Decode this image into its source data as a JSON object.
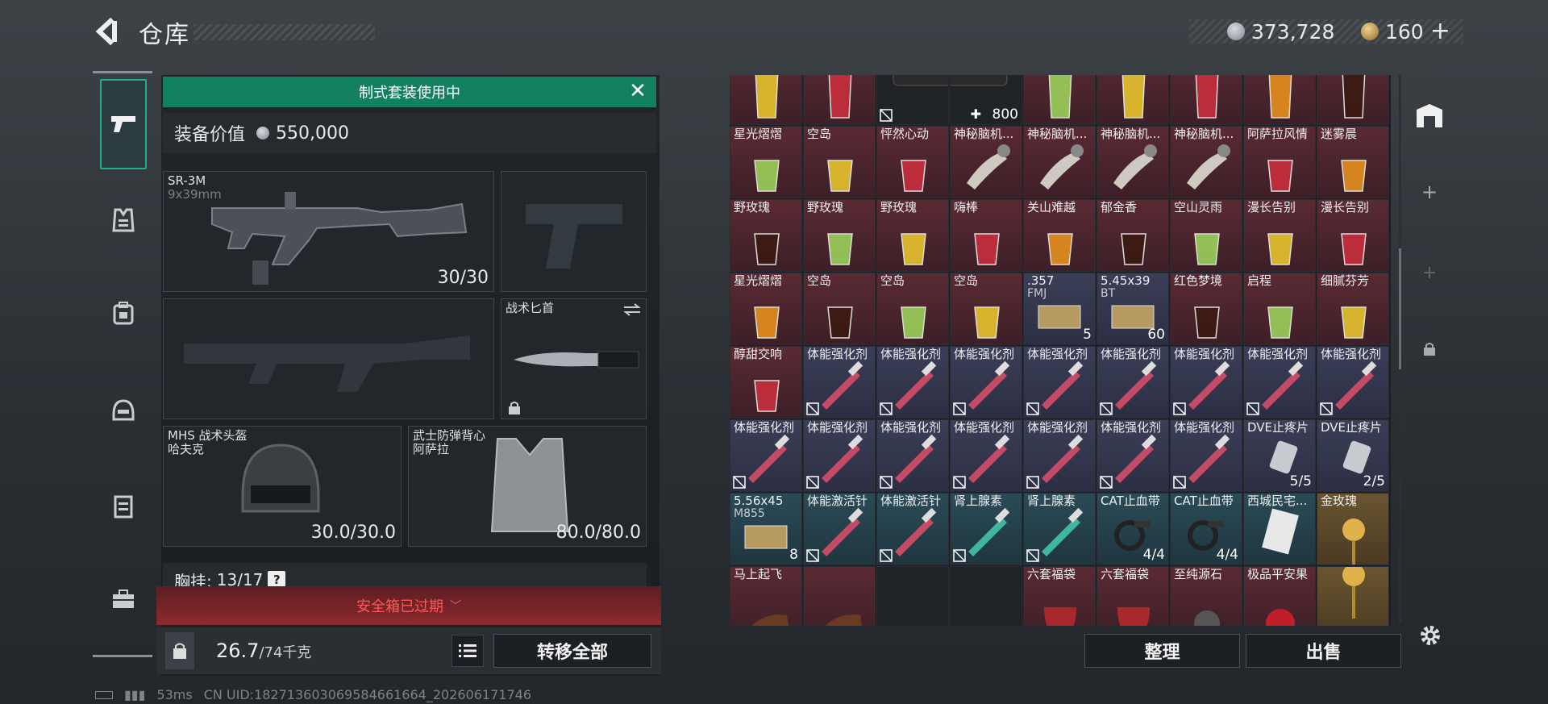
{
  "header": {
    "title": "仓库",
    "currency1": "373,728",
    "currency2": "160",
    "plus": "+"
  },
  "equip": {
    "banner": "制式套装使用中",
    "value_label": "装备价值",
    "value": "550,000",
    "primary": {
      "name": "SR-3M",
      "ammo": "9x39mm",
      "count": "30/30"
    },
    "knife": {
      "name": "战术匕首"
    },
    "helmet": {
      "name": "MHS 战术头盔",
      "sub": "哈夫克",
      "count": "30.0/30.0"
    },
    "armor": {
      "name": "武士防弹背心",
      "sub": "阿萨拉",
      "count": "80.0/80.0"
    },
    "vest_label": "胸挂:",
    "vest_count": "13/17",
    "vest_help": "?",
    "safe_box": "安全箱已过期",
    "weight": "26.7",
    "weight_max": "/74千克",
    "transfer": "转移全部"
  },
  "grid": {
    "rows": [
      [
        {
          "n": "",
          "q": "",
          "t": "red"
        },
        {
          "n": "",
          "q": "",
          "t": "red"
        },
        {
          "n": "",
          "q": "",
          "t": "dark"
        },
        {
          "n": "",
          "q": "800",
          "t": "dark"
        },
        {
          "n": "",
          "q": "",
          "t": "red"
        },
        {
          "n": "",
          "q": "",
          "t": "red"
        },
        {
          "n": "",
          "q": "",
          "t": "red"
        },
        {
          "n": "",
          "q": "",
          "t": "red"
        },
        {
          "n": "",
          "q": "",
          "t": "red"
        }
      ],
      [
        {
          "n": "星光熠熠",
          "q": "",
          "t": "red"
        },
        {
          "n": "空岛",
          "q": "",
          "t": "red"
        },
        {
          "n": "怦然心动",
          "q": "",
          "t": "red"
        },
        {
          "n": "神秘脑机...",
          "q": "",
          "t": "red"
        },
        {
          "n": "神秘脑机...",
          "q": "",
          "t": "red"
        },
        {
          "n": "神秘脑机...",
          "q": "",
          "t": "red"
        },
        {
          "n": "神秘脑机...",
          "q": "",
          "t": "red"
        },
        {
          "n": "阿萨拉风情",
          "q": "",
          "t": "red"
        },
        {
          "n": "迷雾晨",
          "q": "",
          "t": "red"
        }
      ],
      [
        {
          "n": "野玫瑰",
          "q": "",
          "t": "red"
        },
        {
          "n": "野玫瑰",
          "q": "",
          "t": "red"
        },
        {
          "n": "野玫瑰",
          "q": "",
          "t": "red"
        },
        {
          "n": "嗨棒",
          "q": "",
          "t": "red"
        },
        {
          "n": "关山难越",
          "q": "",
          "t": "red"
        },
        {
          "n": "郁金香",
          "q": "",
          "t": "red"
        },
        {
          "n": "空山灵雨",
          "q": "",
          "t": "red"
        },
        {
          "n": "漫长告别",
          "q": "",
          "t": "red"
        },
        {
          "n": "漫长告别",
          "q": "",
          "t": "red"
        }
      ],
      [
        {
          "n": "星光熠熠",
          "q": "",
          "t": "red"
        },
        {
          "n": "空岛",
          "q": "",
          "t": "red"
        },
        {
          "n": "空岛",
          "q": "",
          "t": "red"
        },
        {
          "n": "空岛",
          "q": "",
          "t": "red"
        },
        {
          "n": ".357",
          "n2": "FMJ",
          "q": "5",
          "t": "blue"
        },
        {
          "n": "5.45x39",
          "n2": "BT",
          "q": "60",
          "t": "blue"
        },
        {
          "n": "红色梦境",
          "q": "",
          "t": "red"
        },
        {
          "n": "启程",
          "q": "",
          "t": "red"
        },
        {
          "n": "细腻芬芳",
          "q": "",
          "t": "red"
        }
      ],
      [
        {
          "n": "醇甜交响",
          "q": "",
          "t": "red"
        },
        {
          "n": "体能强化剂",
          "q": "",
          "t": "blue"
        },
        {
          "n": "体能强化剂",
          "q": "",
          "t": "blue"
        },
        {
          "n": "体能强化剂",
          "q": "",
          "t": "blue"
        },
        {
          "n": "体能强化剂",
          "q": "",
          "t": "blue"
        },
        {
          "n": "体能强化剂",
          "q": "",
          "t": "blue"
        },
        {
          "n": "体能强化剂",
          "q": "",
          "t": "blue"
        },
        {
          "n": "体能强化剂",
          "q": "",
          "t": "blue"
        },
        {
          "n": "体能强化剂",
          "q": "",
          "t": "blue"
        }
      ],
      [
        {
          "n": "体能强化剂",
          "q": "",
          "t": "blue"
        },
        {
          "n": "体能强化剂",
          "q": "",
          "t": "blue"
        },
        {
          "n": "体能强化剂",
          "q": "",
          "t": "blue"
        },
        {
          "n": "体能强化剂",
          "q": "",
          "t": "blue"
        },
        {
          "n": "体能强化剂",
          "q": "",
          "t": "blue"
        },
        {
          "n": "体能强化剂",
          "q": "",
          "t": "blue"
        },
        {
          "n": "体能强化剂",
          "q": "",
          "t": "blue"
        },
        {
          "n": "DVE止疼片",
          "q": "5/5",
          "t": "blue"
        },
        {
          "n": "DVE止疼片",
          "q": "2/5",
          "t": "blue"
        }
      ],
      [
        {
          "n": "5.56x45",
          "n2": "M855",
          "q": "8",
          "t": "teal"
        },
        {
          "n": "体能激活针",
          "q": "",
          "t": "teal"
        },
        {
          "n": "体能激活针",
          "q": "",
          "t": "teal"
        },
        {
          "n": "肾上腺素",
          "q": "",
          "t": "teal"
        },
        {
          "n": "肾上腺素",
          "q": "",
          "t": "teal"
        },
        {
          "n": "CAT止血带",
          "q": "4/4",
          "t": "teal"
        },
        {
          "n": "CAT止血带",
          "q": "4/4",
          "t": "teal"
        },
        {
          "n": "西城民宅...",
          "q": "",
          "t": "teal"
        },
        {
          "n": "金玫瑰",
          "q": "",
          "t": "gold"
        }
      ],
      [
        {
          "n": "马上起飞",
          "q": "",
          "t": "red"
        },
        {
          "n": "",
          "q": "",
          "t": "red"
        },
        {
          "n": "",
          "q": "",
          "t": "dark"
        },
        {
          "n": "",
          "q": "",
          "t": "dark"
        },
        {
          "n": "六套福袋",
          "q": "",
          "t": "red"
        },
        {
          "n": "六套福袋",
          "q": "",
          "t": "red"
        },
        {
          "n": "至纯源石",
          "q": "",
          "t": "red"
        },
        {
          "n": "极品平安果",
          "q": "",
          "t": "red"
        },
        {
          "n": "",
          "q": "",
          "t": "gold"
        }
      ]
    ]
  },
  "actions": {
    "sort": "整理",
    "sell": "出售"
  },
  "status": {
    "ping": "53ms",
    "uid": "CN UID:18271360306958466166​4_202606171746"
  },
  "colors": {
    "accent": "#1fae8e",
    "banner": "#138060",
    "danger": "#ff5757"
  }
}
